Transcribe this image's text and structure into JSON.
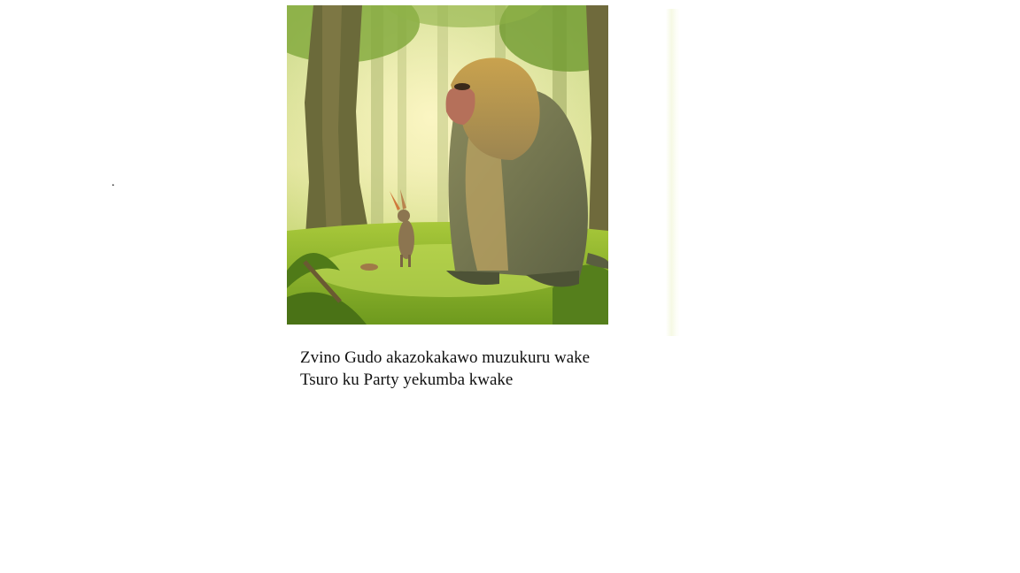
{
  "page": {
    "dot": ".",
    "caption_line_1": "Zvino Gudo akazokakawo muzukuru wake",
    "caption_line_2": "Tsuro ku Party yekumba kwake"
  },
  "illustration": {
    "subject": "baboon-and-hare-in-forest"
  }
}
